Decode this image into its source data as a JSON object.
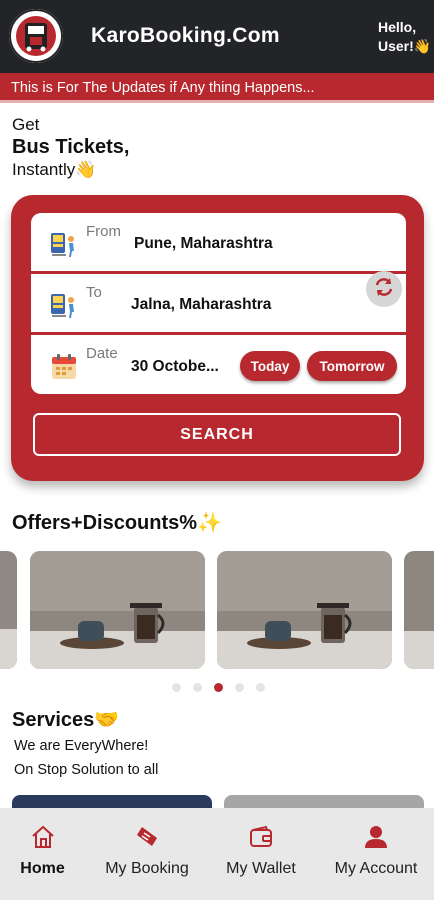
{
  "app": {
    "title": "KaroBooking.Com",
    "greeting_line1": "Hello,",
    "greeting_line2": "User!👋",
    "logo_icon": "bus-ticket-logo-icon"
  },
  "ticker": {
    "text": "This is For The Updates if Any thing Happens..."
  },
  "hero": {
    "line1": "Get",
    "line2": "Bus Tickets,",
    "line3": "Instantly👋"
  },
  "search_form": {
    "from": {
      "label": "From",
      "value": "Pune, Maharashtra",
      "icon": "bus-stop-person-icon"
    },
    "to": {
      "label": "To",
      "value": "Jalna, Maharashtra",
      "icon": "bus-stop-person-icon"
    },
    "date": {
      "label": "Date",
      "value": "30 Octobe...",
      "icon": "calendar-icon"
    },
    "swap_icon": "swap-refresh-icon",
    "today_label": "Today",
    "tomorrow_label": "Tomorrow",
    "search_label": "SEARCH"
  },
  "offers": {
    "title": "Offers+Discounts%✨",
    "slides": 5,
    "active_dot": 3
  },
  "services": {
    "title": "Services🤝",
    "line1": "We are EveryWhere!",
    "line2": "On Stop Solution to all"
  },
  "bottom_nav": {
    "items": [
      {
        "label": "Home",
        "icon": "home-icon",
        "active": true
      },
      {
        "label": "My Booking",
        "icon": "ticket-icon",
        "active": false
      },
      {
        "label": "My Wallet",
        "icon": "wallet-icon",
        "active": false
      },
      {
        "label": "My Account",
        "icon": "account-icon",
        "active": false
      }
    ]
  },
  "colors": {
    "brand_red": "#b7292e",
    "appbar": "#222427",
    "nav_bg": "#e8e8e8"
  }
}
